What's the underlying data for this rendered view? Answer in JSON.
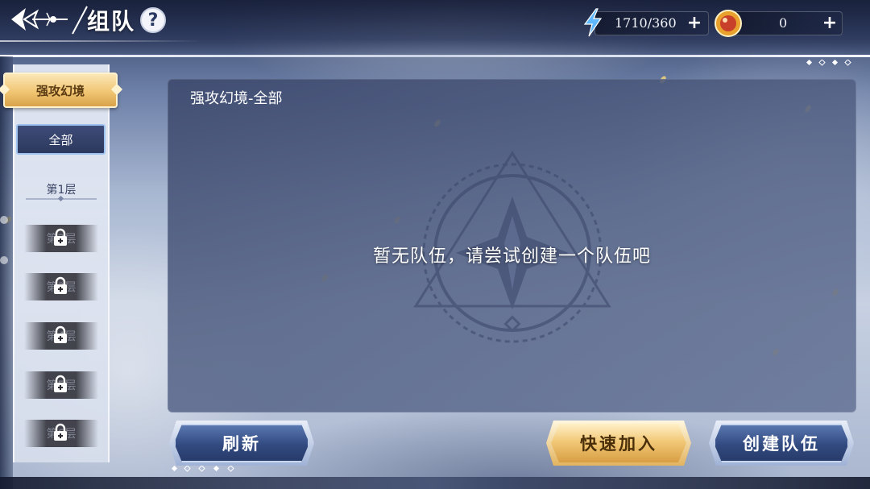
{
  "header": {
    "title": "组队",
    "help_label": "?",
    "resources": [
      {
        "icon": "energy-bolt-icon",
        "value": "1710/360"
      },
      {
        "icon": "gold-coin-icon",
        "value": "0"
      }
    ]
  },
  "sidebar": {
    "category": "强攻幻境",
    "layers": [
      {
        "label": "全部",
        "state": "selected"
      },
      {
        "label": "第1层",
        "state": "unlocked"
      },
      {
        "label": "第2层",
        "state": "locked"
      },
      {
        "label": "第3层",
        "state": "locked"
      },
      {
        "label": "第4层",
        "state": "locked"
      },
      {
        "label": "第5层",
        "state": "locked"
      },
      {
        "label": "第6层",
        "state": "locked"
      }
    ]
  },
  "main": {
    "heading": "强攻幻境-全部",
    "empty_message": "暂无队伍，请尝试创建一个队伍吧"
  },
  "actions": {
    "refresh_label": "刷新",
    "quick_join_label": "快速加入",
    "create_team_label": "创建队伍"
  },
  "colors": {
    "gold_button": "#f2c978",
    "blue_button": "#324a80",
    "selected_border": "#9fc3ef",
    "panel": "#52608a"
  }
}
